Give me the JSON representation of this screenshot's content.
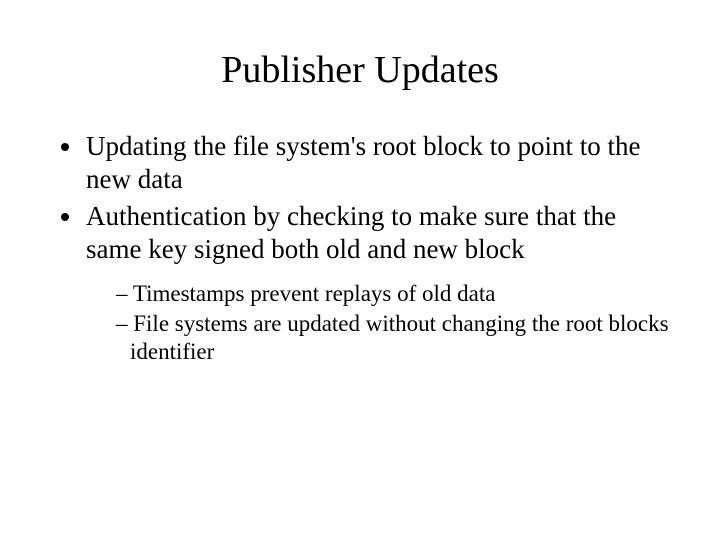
{
  "title": "Publisher Updates",
  "bullets": {
    "b1": "Updating the file system's root block to point to the new data",
    "b2": "Authentication by checking to make sure that the same key signed both old and new block",
    "sub1": "Timestamps prevent replays of old data",
    "sub2": "File systems are updated without changing the root blocks identifier"
  }
}
